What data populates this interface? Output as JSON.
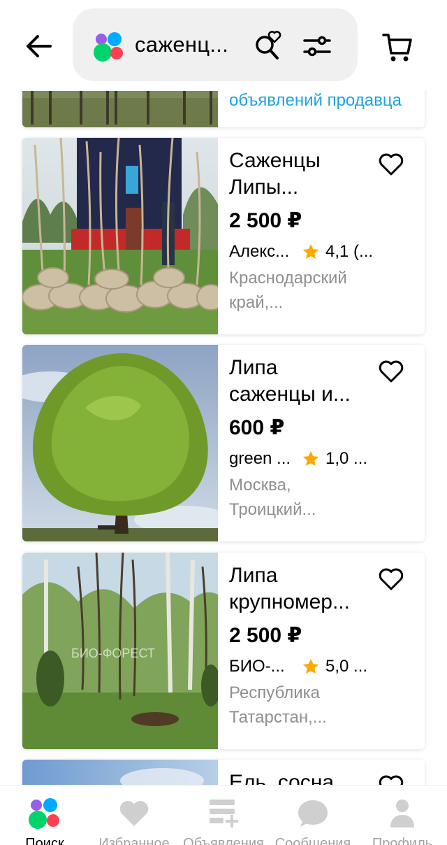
{
  "header": {
    "search_query": "саженц...",
    "back_icon": "arrow-left-icon",
    "search_fav_icon": "search-heart-icon",
    "filter_icon": "sliders-icon",
    "cart_icon": "cart-icon"
  },
  "top_card": {
    "seller_link": "объявлений продавца"
  },
  "listings": [
    {
      "title": "Саженцы\nЛипы...",
      "price": "2 500 ₽",
      "seller": "Алекс...",
      "rating": "4,1 (...",
      "location": "Краснодарский\nкрай,..."
    },
    {
      "title": "Липа\nсаженцы и...",
      "price": "600 ₽",
      "seller": "green ...",
      "rating": "1,0 ...",
      "location": "Москва,\nТроицкий..."
    },
    {
      "title": "Липа\nкрупномер...",
      "price": "2 500 ₽",
      "seller": "БИО-...",
      "rating": "5,0 ...",
      "location": "Республика\nТатарстан,...",
      "watermark": "БИО-ФОРЕСТ"
    }
  ],
  "peek_card": {
    "title": "Ель, сосна"
  },
  "colors": {
    "star": "#ffa800",
    "link": "#1ea3e0",
    "muted_text": "#8f8f8f",
    "nav_inactive": "#cfcfcf"
  },
  "bottom_nav": [
    {
      "label": "Поиск",
      "icon": "brand-icon",
      "active": true
    },
    {
      "label": "Избранное",
      "icon": "heart-icon",
      "active": false
    },
    {
      "label": "Объявления",
      "icon": "ads-add-icon",
      "active": false
    },
    {
      "label": "Сообщения",
      "icon": "chat-bubble-icon",
      "active": false
    },
    {
      "label": "Профиль",
      "icon": "person-icon",
      "active": false
    }
  ]
}
